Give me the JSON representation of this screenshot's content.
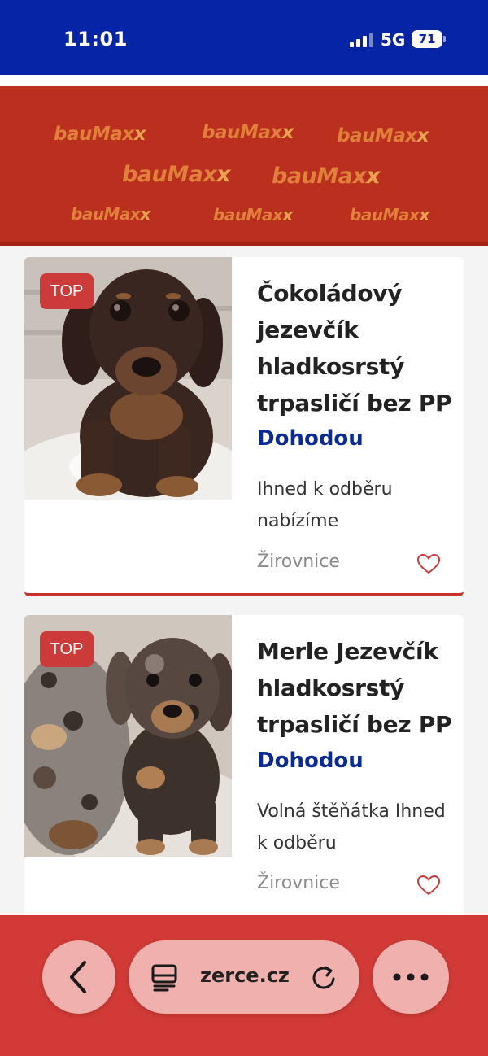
{
  "status_bar": {
    "time": "11:01",
    "network": "5G",
    "battery": "71"
  },
  "banner": {
    "brand": "bauMax",
    "brand_mark": "x",
    "background_color": "#bb2f1f"
  },
  "listings": [
    {
      "badge": "TOP",
      "title": "Čokoládový jezevčík hladkosrstý trpasličí bez PP",
      "price": "Dohodou",
      "description": "Ihned k odběru nabízíme",
      "location": "Žirovnice",
      "image_icon": "dachshund-puppy-photo",
      "favorite_icon": "heart-icon"
    },
    {
      "badge": "TOP",
      "title": "Merle Jezevčík hladkosrstý trpasličí bez PP",
      "price": "Dohodou",
      "description": "Volná štěňátka Ihned k odběru",
      "location": "Žirovnice",
      "image_icon": "merle-dachshund-puppies-photo",
      "favorite_icon": "heart-icon"
    }
  ],
  "browser_bar": {
    "url": "zerce.cz",
    "back_icon": "chevron-left-icon",
    "tabs_icon": "page-icon",
    "reload_icon": "reload-icon",
    "more_icon": "ellipsis-icon"
  },
  "colors": {
    "status_bar": "#0624a6",
    "accent_red": "#d13a36",
    "price_blue": "#0a2a9a",
    "badge_red": "#cc3b39"
  }
}
